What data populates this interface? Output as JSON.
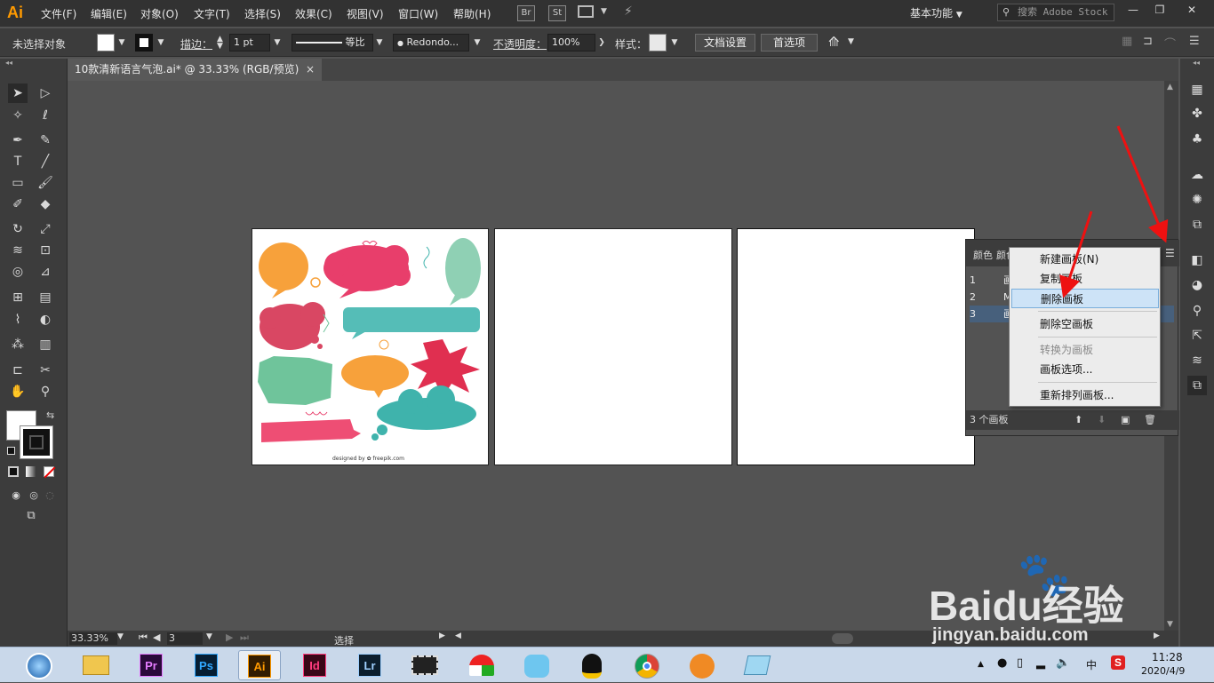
{
  "app": {
    "logo": "Ai",
    "brand_color": "#ff9a00"
  },
  "menus": [
    "文件(F)",
    "编辑(E)",
    "对象(O)",
    "文字(T)",
    "选择(S)",
    "效果(C)",
    "视图(V)",
    "窗口(W)",
    "帮助(H)"
  ],
  "menubar": {
    "br": "Br",
    "st": "St",
    "workspace": "基本功能",
    "search_placeholder": "搜索 Adobe Stock"
  },
  "control": {
    "no_selection": "未选择对象",
    "stroke_label": "描边：",
    "stroke_value": "1 pt",
    "profile_label": "等比",
    "brush_label": "Redondo...",
    "opacity_label": "不透明度：",
    "opacity_value": "100%",
    "style_label": "样式：",
    "doc_setup": "文档设置",
    "preferences": "首选项"
  },
  "document": {
    "tab_title": "10款清新语言气泡.ai* @ 33.33% (RGB/预览)",
    "close": "×"
  },
  "artboard1": {
    "credit": "designed by ✿ freepik.com"
  },
  "status": {
    "zoom": "33.33%",
    "artboard_num": "3",
    "tool": "选择"
  },
  "panel": {
    "tab1": "颜色",
    "tab2": "颜色",
    "rows": [
      {
        "num": "1",
        "name": "画"
      },
      {
        "num": "2",
        "name": "M"
      },
      {
        "num": "3",
        "name": "画"
      }
    ],
    "count": "3 个画板"
  },
  "context_menu": {
    "new": "新建画板(N)",
    "duplicate": "复制画板",
    "delete": "删除画板",
    "delete_empty": "删除空画板",
    "convert": "转换为画板",
    "options": "画板选项...",
    "rearrange": "重新排列画板..."
  },
  "taskbar": {
    "apps": [
      {
        "label": "Pr",
        "bg": "#2a0a3a",
        "fg": "#e57cff"
      },
      {
        "label": "Ps",
        "bg": "#061e33",
        "fg": "#31a8ff"
      },
      {
        "label": "Ai",
        "bg": "#331c00",
        "fg": "#ff9a00"
      },
      {
        "label": "Id",
        "bg": "#3a0718",
        "fg": "#ff3d7f"
      },
      {
        "label": "Lr",
        "bg": "#0c1e2d",
        "fg": "#9fd0ff"
      }
    ],
    "time": "11:28",
    "date": "2020/4/9",
    "ime": "中"
  },
  "watermark": {
    "brand": "Baidu经验",
    "url": "jingyan.baidu.com"
  }
}
